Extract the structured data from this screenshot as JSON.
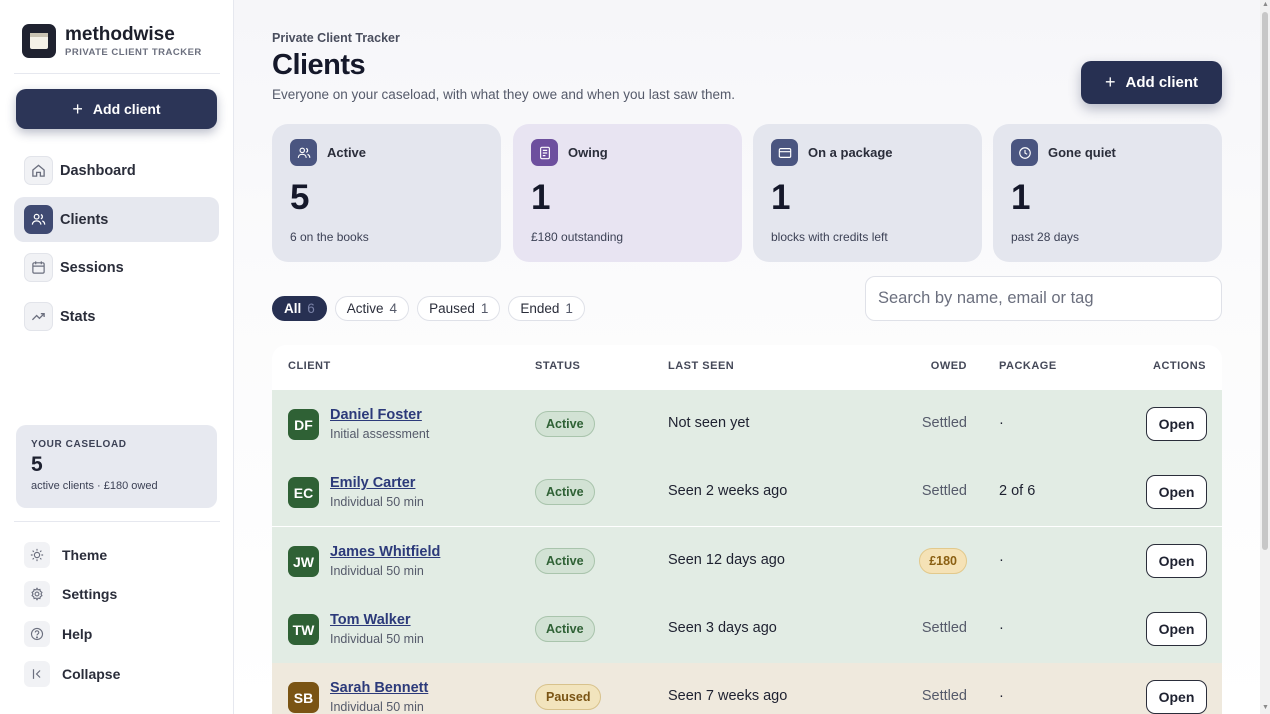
{
  "brand": {
    "name": "methodwise",
    "subtitle": "PRIVATE CLIENT TRACKER"
  },
  "sidebar": {
    "add_label": "Add client",
    "items": [
      {
        "label": "Dashboard",
        "icon": "home-icon",
        "active": false
      },
      {
        "label": "Clients",
        "icon": "users-icon",
        "active": true
      },
      {
        "label": "Sessions",
        "icon": "calendar-icon",
        "active": false
      },
      {
        "label": "Stats",
        "icon": "trend-icon",
        "active": false
      }
    ],
    "caseload": {
      "label": "YOUR CASELOAD",
      "count": "5",
      "summary": "active clients · £180 owed"
    },
    "bottom": [
      {
        "label": "Theme",
        "icon": "sun-icon"
      },
      {
        "label": "Settings",
        "icon": "gear-icon"
      },
      {
        "label": "Help",
        "icon": "help-icon"
      },
      {
        "label": "Collapse",
        "icon": "collapse-icon"
      }
    ]
  },
  "header": {
    "breadcrumb": "Private Client Tracker",
    "title": "Clients",
    "subtitle": "Everyone on your caseload, with what they owe and when you last saw them.",
    "add_label": "Add client"
  },
  "stats": [
    {
      "title": "Active",
      "value": "5",
      "sub": "6 on the books",
      "icon": "users-icon"
    },
    {
      "title": "Owing",
      "value": "1",
      "sub": "£180 outstanding",
      "icon": "invoice-icon"
    },
    {
      "title": "On a package",
      "value": "1",
      "sub": "blocks with credits left",
      "icon": "card-icon"
    },
    {
      "title": "Gone quiet",
      "value": "1",
      "sub": "past 28 days",
      "icon": "clock-icon"
    }
  ],
  "filters": [
    {
      "label": "All",
      "count": "6",
      "selected": true
    },
    {
      "label": "Active",
      "count": "4",
      "selected": false
    },
    {
      "label": "Paused",
      "count": "1",
      "selected": false
    },
    {
      "label": "Ended",
      "count": "1",
      "selected": false
    }
  ],
  "search": {
    "placeholder": "Search by name, email or tag",
    "value": ""
  },
  "table": {
    "columns": {
      "client": "CLIENT",
      "status": "STATUS",
      "last_seen": "LAST SEEN",
      "owed": "OWED",
      "package": "PACKAGE",
      "actions": "ACTIONS"
    },
    "action_label": "Open",
    "rows": [
      {
        "initials": "DF",
        "name": "Daniel Foster",
        "service": "Initial assessment",
        "status": "Active",
        "last_seen": "Not seen yet",
        "owed": "Settled",
        "owing": false,
        "package": "·"
      },
      {
        "initials": "EC",
        "name": "Emily Carter",
        "service": "Individual 50 min",
        "status": "Active",
        "last_seen": "Seen 2 weeks ago",
        "owed": "Settled",
        "owing": false,
        "package": "2 of 6"
      },
      {
        "initials": "JW",
        "name": "James Whitfield",
        "service": "Individual 50 min",
        "status": "Active",
        "last_seen": "Seen 12 days ago",
        "owed": "£180",
        "owing": true,
        "package": "·"
      },
      {
        "initials": "TW",
        "name": "Tom Walker",
        "service": "Individual 50 min",
        "status": "Active",
        "last_seen": "Seen 3 days ago",
        "owed": "Settled",
        "owing": false,
        "package": "·"
      },
      {
        "initials": "SB",
        "name": "Sarah Bennett",
        "service": "Individual 50 min",
        "status": "Paused",
        "last_seen": "Seen 7 weeks ago",
        "owed": "Settled",
        "owing": false,
        "package": "·"
      }
    ]
  },
  "colors": {
    "primary": "#273052",
    "active_status": "#2f6135",
    "paused_status": "#7a5414",
    "owed_badge": "#f5e2b6"
  }
}
